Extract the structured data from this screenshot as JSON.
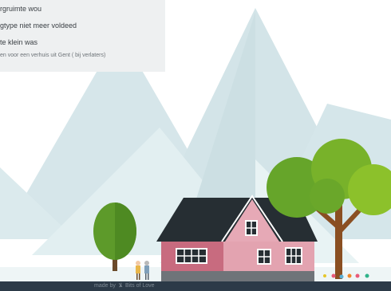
{
  "options": [
    {
      "label": "rgruimte wou"
    },
    {
      "label": "gtype niet meer voldeed"
    },
    {
      "label": "te klein was"
    }
  ],
  "note": "en voor een verhuis uit Gent ( bij verlaters)",
  "footer": {
    "made_by": "made by",
    "brand": "Bits of Love",
    "logo_glyph": "ﻼ"
  },
  "colors": {
    "footer_bg": "#2c3a48",
    "panel_bg": "#eef0f1",
    "mountain": "#d3e5e8",
    "house_pink": "#d98a9b",
    "roof": "#262e33",
    "tree_green": "#6fa82a"
  }
}
